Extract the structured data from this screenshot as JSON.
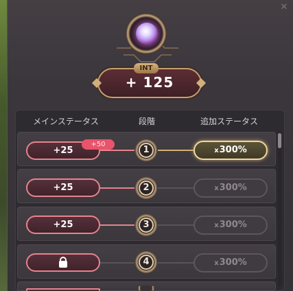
{
  "window": {
    "close_glyph": "✕"
  },
  "stat": {
    "label": "INT",
    "value": "+ 125"
  },
  "headers": {
    "main_status": "メインステータス",
    "stage": "段階",
    "added_status": "追加ステータス"
  },
  "rows": [
    {
      "main": "+25",
      "bonus": "+50",
      "stage": "1",
      "added_prefix": "x",
      "added_value": "300%",
      "active": true
    },
    {
      "main": "+25",
      "stage": "2",
      "added_prefix": "x",
      "added_value": "300%",
      "active": false
    },
    {
      "main": "+25",
      "stage": "3",
      "added_prefix": "x",
      "added_value": "300%",
      "active": false
    },
    {
      "main_icon": "lock-icon",
      "stage": "4",
      "added_prefix": "x",
      "added_value": "300%",
      "active": false
    }
  ],
  "colors": {
    "accent_pink": "#e7848f",
    "accent_gold": "#d2b07a",
    "bonus_badge": "#e8546b"
  }
}
